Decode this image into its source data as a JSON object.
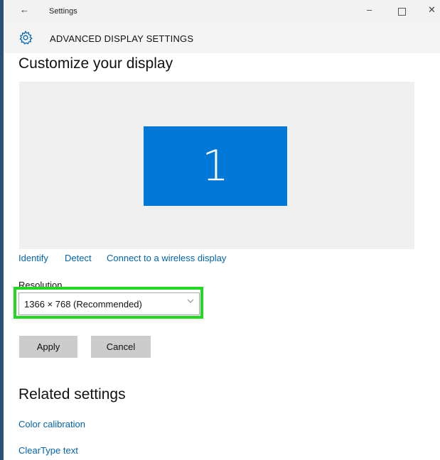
{
  "window": {
    "app_title": "Settings",
    "back_glyph": "←",
    "minimize_glyph": "–",
    "close_glyph": "✕"
  },
  "header": {
    "title": "ADVANCED DISPLAY SETTINGS",
    "icon": "gear-icon"
  },
  "customize": {
    "heading": "Customize your display",
    "monitor_number": "1",
    "monitor_color": "#0078d7"
  },
  "links": {
    "identify": "Identify",
    "detect": "Detect",
    "wireless": "Connect to a wireless display"
  },
  "resolution": {
    "label": "Resolution",
    "value": "1366 × 768 (Recommended)",
    "highlight_color": "#23d822"
  },
  "buttons": {
    "apply": "Apply",
    "cancel": "Cancel"
  },
  "related": {
    "heading": "Related settings",
    "links": [
      "Color calibration",
      "ClearType text"
    ]
  },
  "colors": {
    "accent": "#0063b1",
    "left_edge": "#2b4f79"
  }
}
